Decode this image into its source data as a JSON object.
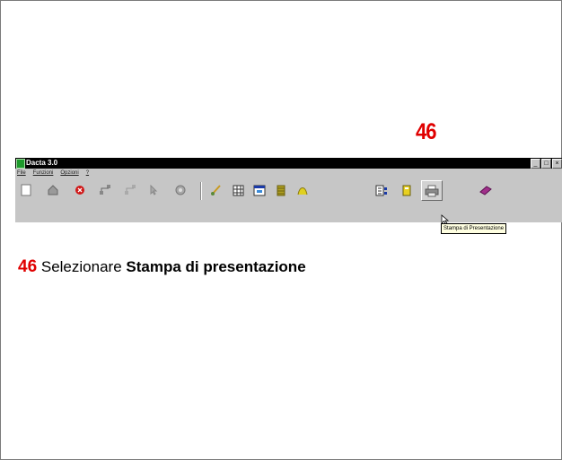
{
  "step_number": "46",
  "app": {
    "title": "Dacta 3.0",
    "menu": [
      "File",
      "Funzioni",
      "Opzioni",
      "?"
    ],
    "window_controls": [
      "minimize",
      "maximize",
      "close"
    ],
    "toolbar": {
      "icons": [
        "new-document-icon",
        "home-icon",
        "stop-icon",
        "network-icon",
        "network-gray-icon",
        "pointer-icon",
        "tools-icon",
        "brush-icon",
        "grid-icon",
        "window-icon",
        "stack-icon",
        "curve-icon",
        "list-icon",
        "notebook-icon",
        "printer-icon",
        "book-icon"
      ],
      "pressed": "printer-icon",
      "tooltip": "Stampa di Presentazione"
    }
  },
  "caption": {
    "number": "46",
    "text_prefix": " Selezionare ",
    "text_bold": "Stampa di presentazione"
  },
  "colors": {
    "accent_red": "#e00000",
    "toolbar_gray": "#c6c6c6",
    "titlebar": "#000000"
  }
}
